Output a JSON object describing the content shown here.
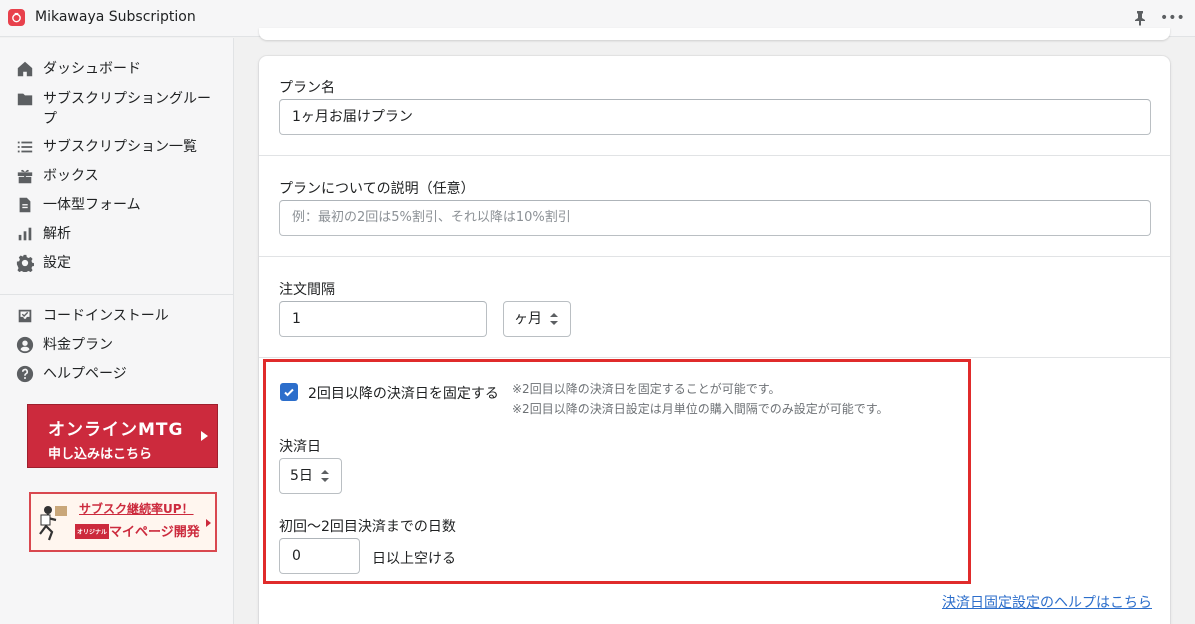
{
  "app": {
    "title": "Mikawaya Subscription"
  },
  "sidebar": {
    "items": [
      {
        "label": "ダッシュボード",
        "icon": "home-icon"
      },
      {
        "label": "サブスクリプショングループ",
        "icon": "folder-icon"
      },
      {
        "label": "サブスクリプション一覧",
        "icon": "list-icon"
      },
      {
        "label": "ボックス",
        "icon": "gift-icon"
      },
      {
        "label": "一体型フォーム",
        "icon": "document-icon"
      },
      {
        "label": "解析",
        "icon": "bar-chart-icon"
      },
      {
        "label": "設定",
        "icon": "gear-icon"
      }
    ],
    "items2": [
      {
        "label": "コードインストール",
        "icon": "inbox-icon"
      },
      {
        "label": "料金プラン",
        "icon": "user-icon"
      },
      {
        "label": "ヘルプページ",
        "icon": "question-icon"
      }
    ],
    "banner_mtg": {
      "line1": "オンラインMTG",
      "line2": "申し込みはこちら"
    },
    "banner_mypage": {
      "line1": "サブスク継続率UP！",
      "tag": "オリジナル",
      "line2": "マイページ開発"
    }
  },
  "form": {
    "plan_name": {
      "label": "プラン名",
      "value": "1ヶ月お届けプラン"
    },
    "description": {
      "label": "プランについての説明（任意）",
      "placeholder": "例：最初の2回は5%割引、それ以降は10%割引"
    },
    "interval": {
      "label": "注文間隔",
      "value": "1",
      "unit": "ヶ月"
    },
    "fixed_billing": {
      "checkbox_label": "2回目以降の決済日を固定する",
      "checked": true,
      "note1": "※2回目以降の決済日を固定することが可能です。",
      "note2": "※2回目以降の決済日設定は月単位の購入間隔でのみ設定が可能です。",
      "billing_day_label": "決済日",
      "billing_day_value": "5日",
      "days_label": "初回〜2回目決済までの日数",
      "days_value": "0",
      "days_suffix": "日以上空ける"
    },
    "help_link": "決済日固定設定のヘルプはこちら"
  },
  "colors": {
    "accent": "#2c6ecb",
    "highlight": "#e02b2b",
    "banner": "#cc2a3d"
  }
}
